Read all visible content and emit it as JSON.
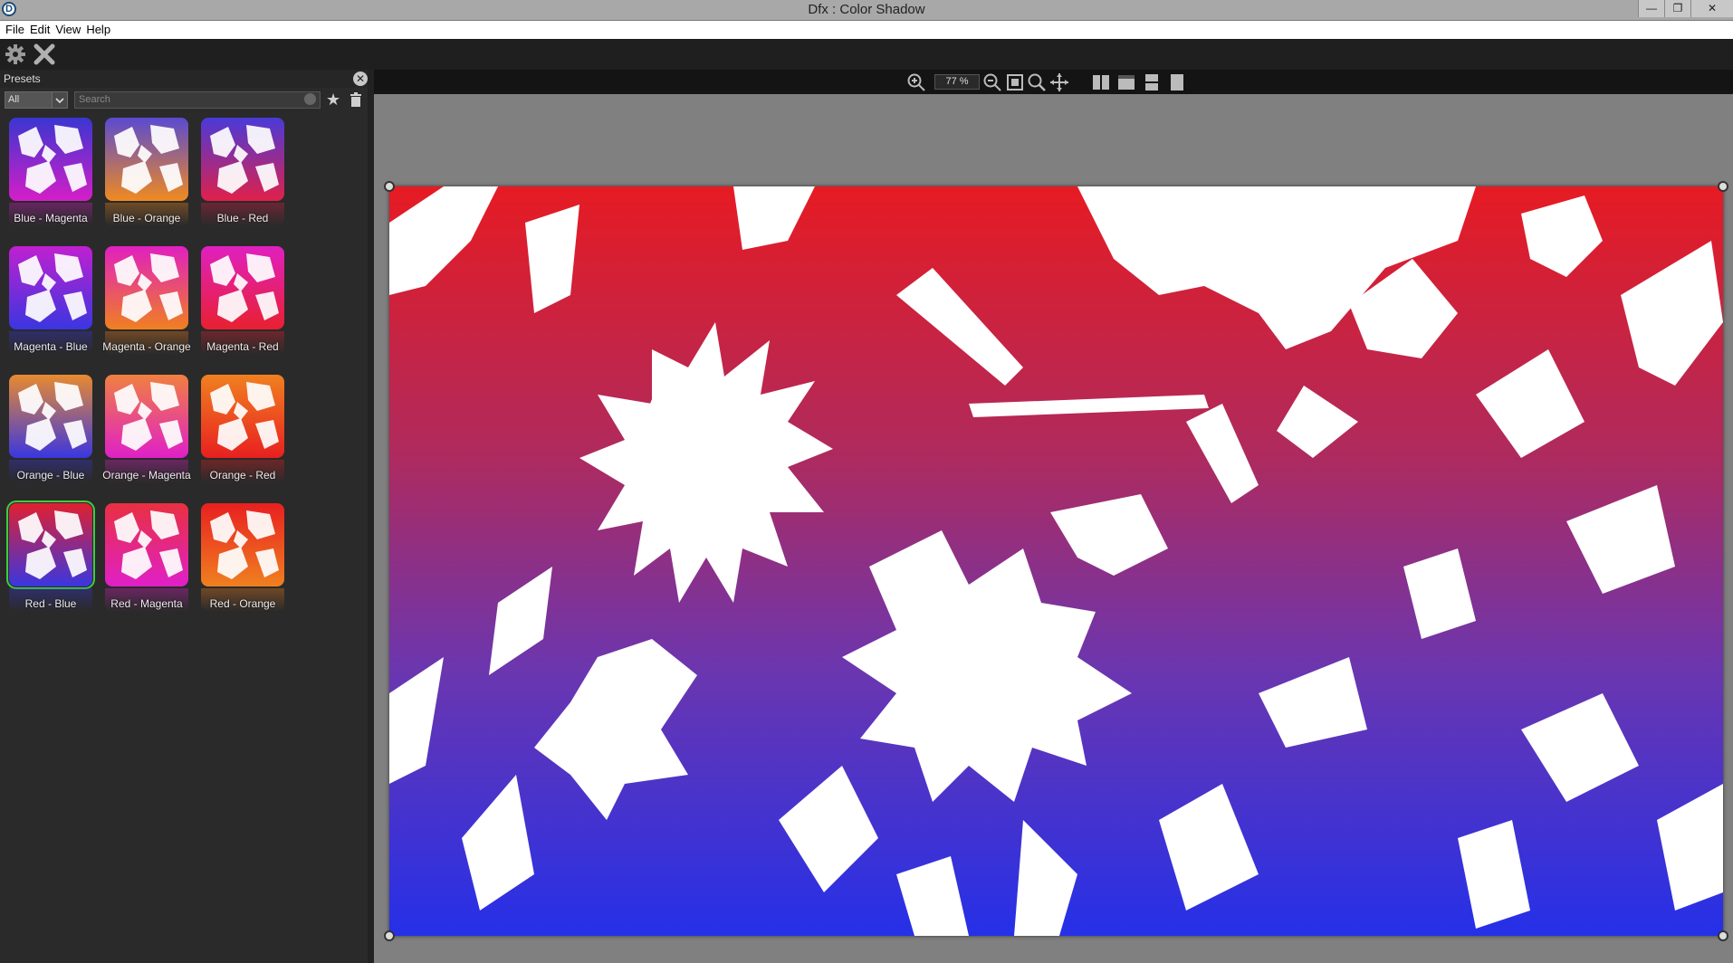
{
  "window": {
    "title": "Dfx : Color Shadow",
    "app_icon": "app-logo-icon",
    "buttons": {
      "minimize": "—",
      "restore": "❐",
      "close": "✕"
    }
  },
  "menu": {
    "items": [
      {
        "label": "File"
      },
      {
        "label": "Edit"
      },
      {
        "label": "View"
      },
      {
        "label": "Help"
      }
    ]
  },
  "toolbar": {
    "icons": [
      "gear-icon",
      "close-x-icon"
    ]
  },
  "presets_panel": {
    "title": "Presets",
    "filter": {
      "selected": "All"
    },
    "search": {
      "placeholder": "Search"
    },
    "items": [
      {
        "label": "Blue - Magenta",
        "from": "#3a36d0",
        "to": "#d51ec8"
      },
      {
        "label": "Blue - Orange",
        "from": "#5a4ad0",
        "to": "#f08a20"
      },
      {
        "label": "Blue - Red",
        "from": "#4a3ad8",
        "to": "#e0204a"
      },
      {
        "label": "Magenta - Blue",
        "from": "#c020d0",
        "to": "#3a36e0"
      },
      {
        "label": "Magenta - Orange",
        "from": "#e020c0",
        "to": "#f08020"
      },
      {
        "label": "Magenta - Red",
        "from": "#e020c0",
        "to": "#e82030"
      },
      {
        "label": "Orange - Blue",
        "from": "#e88a30",
        "to": "#3a36e0"
      },
      {
        "label": "Orange - Magenta",
        "from": "#f08040",
        "to": "#e020c8"
      },
      {
        "label": "Orange - Red",
        "from": "#f08020",
        "to": "#e82020"
      },
      {
        "label": "Red - Blue",
        "from": "#e02030",
        "to": "#3a36e0"
      },
      {
        "label": "Red - Magenta",
        "from": "#e83040",
        "to": "#e020c8"
      },
      {
        "label": "Red - Orange",
        "from": "#e82020",
        "to": "#f08020"
      }
    ],
    "selected_index": 9
  },
  "viewbar": {
    "zoom": "77 %",
    "icons": [
      "zoom-in-icon",
      "zoom-out-icon",
      "fit-icon",
      "zoom-icon",
      "pan-icon",
      "split-vertical-icon",
      "split-compare-icon",
      "split-horizontal-icon",
      "single-view-icon"
    ]
  },
  "canvas": {
    "gradient_top": "#e61b23",
    "gradient_bottom": "#2530e8"
  }
}
